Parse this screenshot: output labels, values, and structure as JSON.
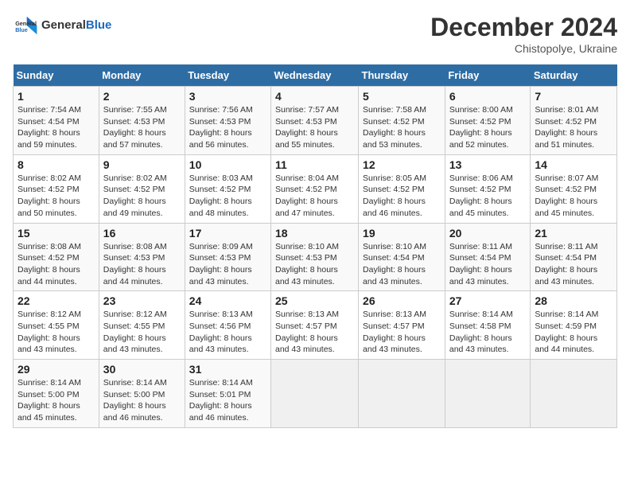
{
  "header": {
    "logo_line1": "General",
    "logo_line2": "Blue",
    "month": "December 2024",
    "location": "Chistopolye, Ukraine"
  },
  "days_of_week": [
    "Sunday",
    "Monday",
    "Tuesday",
    "Wednesday",
    "Thursday",
    "Friday",
    "Saturday"
  ],
  "weeks": [
    [
      {
        "day": "1",
        "sunrise": "Sunrise: 7:54 AM",
        "sunset": "Sunset: 4:54 PM",
        "daylight": "Daylight: 8 hours and 59 minutes."
      },
      {
        "day": "2",
        "sunrise": "Sunrise: 7:55 AM",
        "sunset": "Sunset: 4:53 PM",
        "daylight": "Daylight: 8 hours and 57 minutes."
      },
      {
        "day": "3",
        "sunrise": "Sunrise: 7:56 AM",
        "sunset": "Sunset: 4:53 PM",
        "daylight": "Daylight: 8 hours and 56 minutes."
      },
      {
        "day": "4",
        "sunrise": "Sunrise: 7:57 AM",
        "sunset": "Sunset: 4:53 PM",
        "daylight": "Daylight: 8 hours and 55 minutes."
      },
      {
        "day": "5",
        "sunrise": "Sunrise: 7:58 AM",
        "sunset": "Sunset: 4:52 PM",
        "daylight": "Daylight: 8 hours and 53 minutes."
      },
      {
        "day": "6",
        "sunrise": "Sunrise: 8:00 AM",
        "sunset": "Sunset: 4:52 PM",
        "daylight": "Daylight: 8 hours and 52 minutes."
      },
      {
        "day": "7",
        "sunrise": "Sunrise: 8:01 AM",
        "sunset": "Sunset: 4:52 PM",
        "daylight": "Daylight: 8 hours and 51 minutes."
      }
    ],
    [
      {
        "day": "8",
        "sunrise": "Sunrise: 8:02 AM",
        "sunset": "Sunset: 4:52 PM",
        "daylight": "Daylight: 8 hours and 50 minutes."
      },
      {
        "day": "9",
        "sunrise": "Sunrise: 8:02 AM",
        "sunset": "Sunset: 4:52 PM",
        "daylight": "Daylight: 8 hours and 49 minutes."
      },
      {
        "day": "10",
        "sunrise": "Sunrise: 8:03 AM",
        "sunset": "Sunset: 4:52 PM",
        "daylight": "Daylight: 8 hours and 48 minutes."
      },
      {
        "day": "11",
        "sunrise": "Sunrise: 8:04 AM",
        "sunset": "Sunset: 4:52 PM",
        "daylight": "Daylight: 8 hours and 47 minutes."
      },
      {
        "day": "12",
        "sunrise": "Sunrise: 8:05 AM",
        "sunset": "Sunset: 4:52 PM",
        "daylight": "Daylight: 8 hours and 46 minutes."
      },
      {
        "day": "13",
        "sunrise": "Sunrise: 8:06 AM",
        "sunset": "Sunset: 4:52 PM",
        "daylight": "Daylight: 8 hours and 45 minutes."
      },
      {
        "day": "14",
        "sunrise": "Sunrise: 8:07 AM",
        "sunset": "Sunset: 4:52 PM",
        "daylight": "Daylight: 8 hours and 45 minutes."
      }
    ],
    [
      {
        "day": "15",
        "sunrise": "Sunrise: 8:08 AM",
        "sunset": "Sunset: 4:52 PM",
        "daylight": "Daylight: 8 hours and 44 minutes."
      },
      {
        "day": "16",
        "sunrise": "Sunrise: 8:08 AM",
        "sunset": "Sunset: 4:53 PM",
        "daylight": "Daylight: 8 hours and 44 minutes."
      },
      {
        "day": "17",
        "sunrise": "Sunrise: 8:09 AM",
        "sunset": "Sunset: 4:53 PM",
        "daylight": "Daylight: 8 hours and 43 minutes."
      },
      {
        "day": "18",
        "sunrise": "Sunrise: 8:10 AM",
        "sunset": "Sunset: 4:53 PM",
        "daylight": "Daylight: 8 hours and 43 minutes."
      },
      {
        "day": "19",
        "sunrise": "Sunrise: 8:10 AM",
        "sunset": "Sunset: 4:54 PM",
        "daylight": "Daylight: 8 hours and 43 minutes."
      },
      {
        "day": "20",
        "sunrise": "Sunrise: 8:11 AM",
        "sunset": "Sunset: 4:54 PM",
        "daylight": "Daylight: 8 hours and 43 minutes."
      },
      {
        "day": "21",
        "sunrise": "Sunrise: 8:11 AM",
        "sunset": "Sunset: 4:54 PM",
        "daylight": "Daylight: 8 hours and 43 minutes."
      }
    ],
    [
      {
        "day": "22",
        "sunrise": "Sunrise: 8:12 AM",
        "sunset": "Sunset: 4:55 PM",
        "daylight": "Daylight: 8 hours and 43 minutes."
      },
      {
        "day": "23",
        "sunrise": "Sunrise: 8:12 AM",
        "sunset": "Sunset: 4:55 PM",
        "daylight": "Daylight: 8 hours and 43 minutes."
      },
      {
        "day": "24",
        "sunrise": "Sunrise: 8:13 AM",
        "sunset": "Sunset: 4:56 PM",
        "daylight": "Daylight: 8 hours and 43 minutes."
      },
      {
        "day": "25",
        "sunrise": "Sunrise: 8:13 AM",
        "sunset": "Sunset: 4:57 PM",
        "daylight": "Daylight: 8 hours and 43 minutes."
      },
      {
        "day": "26",
        "sunrise": "Sunrise: 8:13 AM",
        "sunset": "Sunset: 4:57 PM",
        "daylight": "Daylight: 8 hours and 43 minutes."
      },
      {
        "day": "27",
        "sunrise": "Sunrise: 8:14 AM",
        "sunset": "Sunset: 4:58 PM",
        "daylight": "Daylight: 8 hours and 43 minutes."
      },
      {
        "day": "28",
        "sunrise": "Sunrise: 8:14 AM",
        "sunset": "Sunset: 4:59 PM",
        "daylight": "Daylight: 8 hours and 44 minutes."
      }
    ],
    [
      {
        "day": "29",
        "sunrise": "Sunrise: 8:14 AM",
        "sunset": "Sunset: 5:00 PM",
        "daylight": "Daylight: 8 hours and 45 minutes."
      },
      {
        "day": "30",
        "sunrise": "Sunrise: 8:14 AM",
        "sunset": "Sunset: 5:00 PM",
        "daylight": "Daylight: 8 hours and 46 minutes."
      },
      {
        "day": "31",
        "sunrise": "Sunrise: 8:14 AM",
        "sunset": "Sunset: 5:01 PM",
        "daylight": "Daylight: 8 hours and 46 minutes."
      },
      null,
      null,
      null,
      null
    ]
  ]
}
